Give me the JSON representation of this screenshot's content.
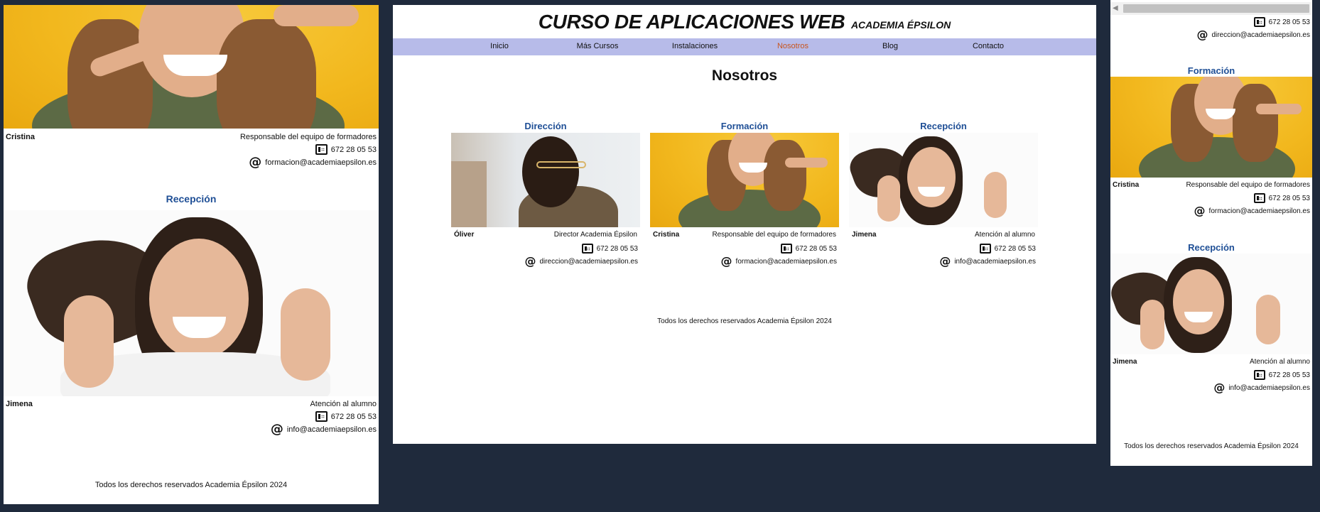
{
  "site": {
    "title": "CURSO DE APLICACIONES WEB",
    "subtitle": "ACADEMIA ÉPSILON"
  },
  "nav": [
    {
      "label": "Inicio",
      "active": false
    },
    {
      "label": "Más Cursos",
      "active": false
    },
    {
      "label": "Instalaciones",
      "active": false
    },
    {
      "label": "Nosotros",
      "active": true
    },
    {
      "label": "Blog",
      "active": false
    },
    {
      "label": "Contacto",
      "active": false
    }
  ],
  "page": {
    "heading": "Nosotros",
    "footer": "Todos los derechos reservados Academia Épsilon 2024"
  },
  "team": [
    {
      "section": "Dirección",
      "name": "Óliver",
      "role": "Director Academia Épsilon",
      "phone": "672 28 05 53",
      "email": "direccion@academiaepsilon.es",
      "photo_icon": "man-with-glasses-photo"
    },
    {
      "section": "Formación",
      "name": "Cristina",
      "role": "Responsable del equipo de formadores",
      "phone": "672 28 05 53",
      "email": "formacion@academiaepsilon.es",
      "photo_icon": "woman-pointing-photo"
    },
    {
      "section": "Recepción",
      "name": "Jimena",
      "role": "Atención al alumno",
      "phone": "672 28 05 53",
      "email": "info@academiaepsilon.es",
      "photo_icon": "woman-thumbs-up-photo"
    }
  ],
  "icons": {
    "phone": "phone-icon",
    "email": "at-sign-icon",
    "scroll_left": "chevron-left-icon"
  },
  "colors": {
    "background": "#1f2a3c",
    "nav_bg": "#b7bbe9",
    "nav_active": "#c8551e",
    "section_title": "#1f4f96"
  }
}
